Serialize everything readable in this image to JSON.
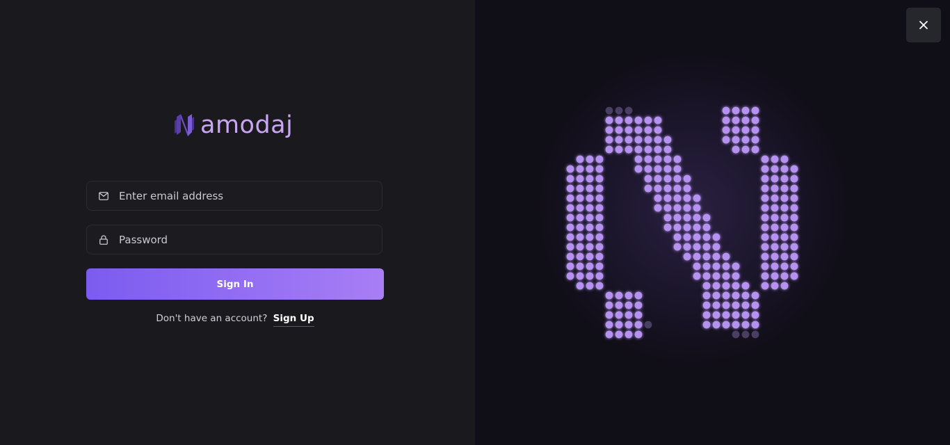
{
  "brand": {
    "name": "amodaj",
    "mark_letter": "N",
    "color": "#c9a6f2"
  },
  "form": {
    "email": {
      "placeholder": "Enter email address",
      "icon": "mail-icon"
    },
    "password": {
      "placeholder": "Password",
      "icon": "lock-icon"
    },
    "signin_label": "Sign In",
    "signup_prompt": "Don't have an account?",
    "signup_label": "Sign Up"
  },
  "close": {
    "icon": "close-icon"
  },
  "colors": {
    "accent_start": "#7b5cf0",
    "accent_end": "#a87ef5",
    "dot_color": "#b592f0",
    "dot_dim": "#4a3f63"
  }
}
